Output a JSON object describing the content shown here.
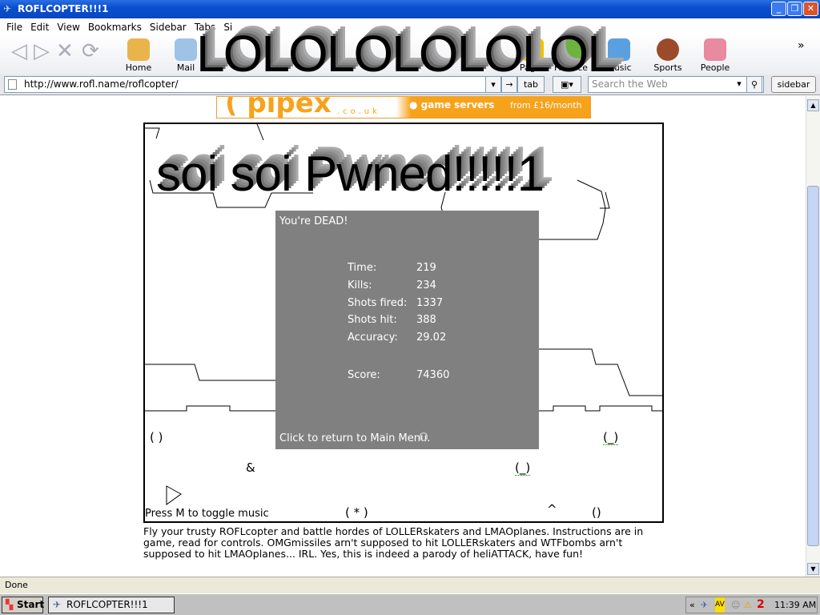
{
  "window": {
    "title": "ROFLCOPTER!!!1"
  },
  "menu": [
    "File",
    "Edit",
    "View",
    "Bookmarks",
    "Sidebar",
    "Tabs",
    "Si"
  ],
  "toolbar": {
    "items": [
      {
        "label": "Home",
        "color": "#e9b44a"
      },
      {
        "label": "Mail",
        "color": "#9ec3e6"
      },
      {
        "label": "Pages",
        "color": "#f2c200"
      },
      {
        "label": "Finance",
        "color": "#6cb33f"
      },
      {
        "label": "Music",
        "color": "#5aa0e0"
      },
      {
        "label": "Sports",
        "color": "#9b4a2a"
      },
      {
        "label": "People",
        "color": "#e88aa0"
      }
    ],
    "more": "»"
  },
  "address": {
    "url": "http://www.rofl.name/roflcopter/",
    "tab_label": "tab",
    "search_placeholder": "Search the Web",
    "sidebar_label": "sidebar"
  },
  "banner": {
    "logo": "pipex",
    "domain": ".co.uk",
    "tagline": "● game servers",
    "price": "from £16/month"
  },
  "overlay": {
    "lol": "LOLOLOLOLOLOL",
    "pwned": "soi soi Pwned!!!!!1"
  },
  "game": {
    "dead_title": "You're DEAD!",
    "stats": [
      {
        "label": "Time:",
        "value": "219"
      },
      {
        "label": "Kills:",
        "value": "234"
      },
      {
        "label": "Shots fired:",
        "value": "1337"
      },
      {
        "label": "Shots hit:",
        "value": "388"
      },
      {
        "label": "Accuracy:",
        "value": "29.02"
      },
      {
        "label": "Score:",
        "value": "74360"
      }
    ],
    "return_label": "Click to return to Main Menu.",
    "music_hint": "Press M to toggle music",
    "glyphs": {
      "a": "( )",
      "b": "&",
      "c": "( * )",
      "d": "^",
      "e": "()",
      "f": "(_)",
      "g": "(_)",
      "h": "O"
    }
  },
  "description": "Fly your trusty ROFLcopter and battle hordes of LOLLERskaters and LMAOplanes. Instructions are in game, read for controls. OMGmissiles arn't supposed to hit LOLLERskaters and WTFbombs arn't supposed to hit LMAOplanes... IRL. Yes, this is indeed a parody of heliATTACK, have fun!",
  "status": "Done",
  "taskbar": {
    "start": "Start",
    "task": "ROFLCOPTER!!!1",
    "clock": "11:39 AM",
    "tray_collapse": "«"
  }
}
